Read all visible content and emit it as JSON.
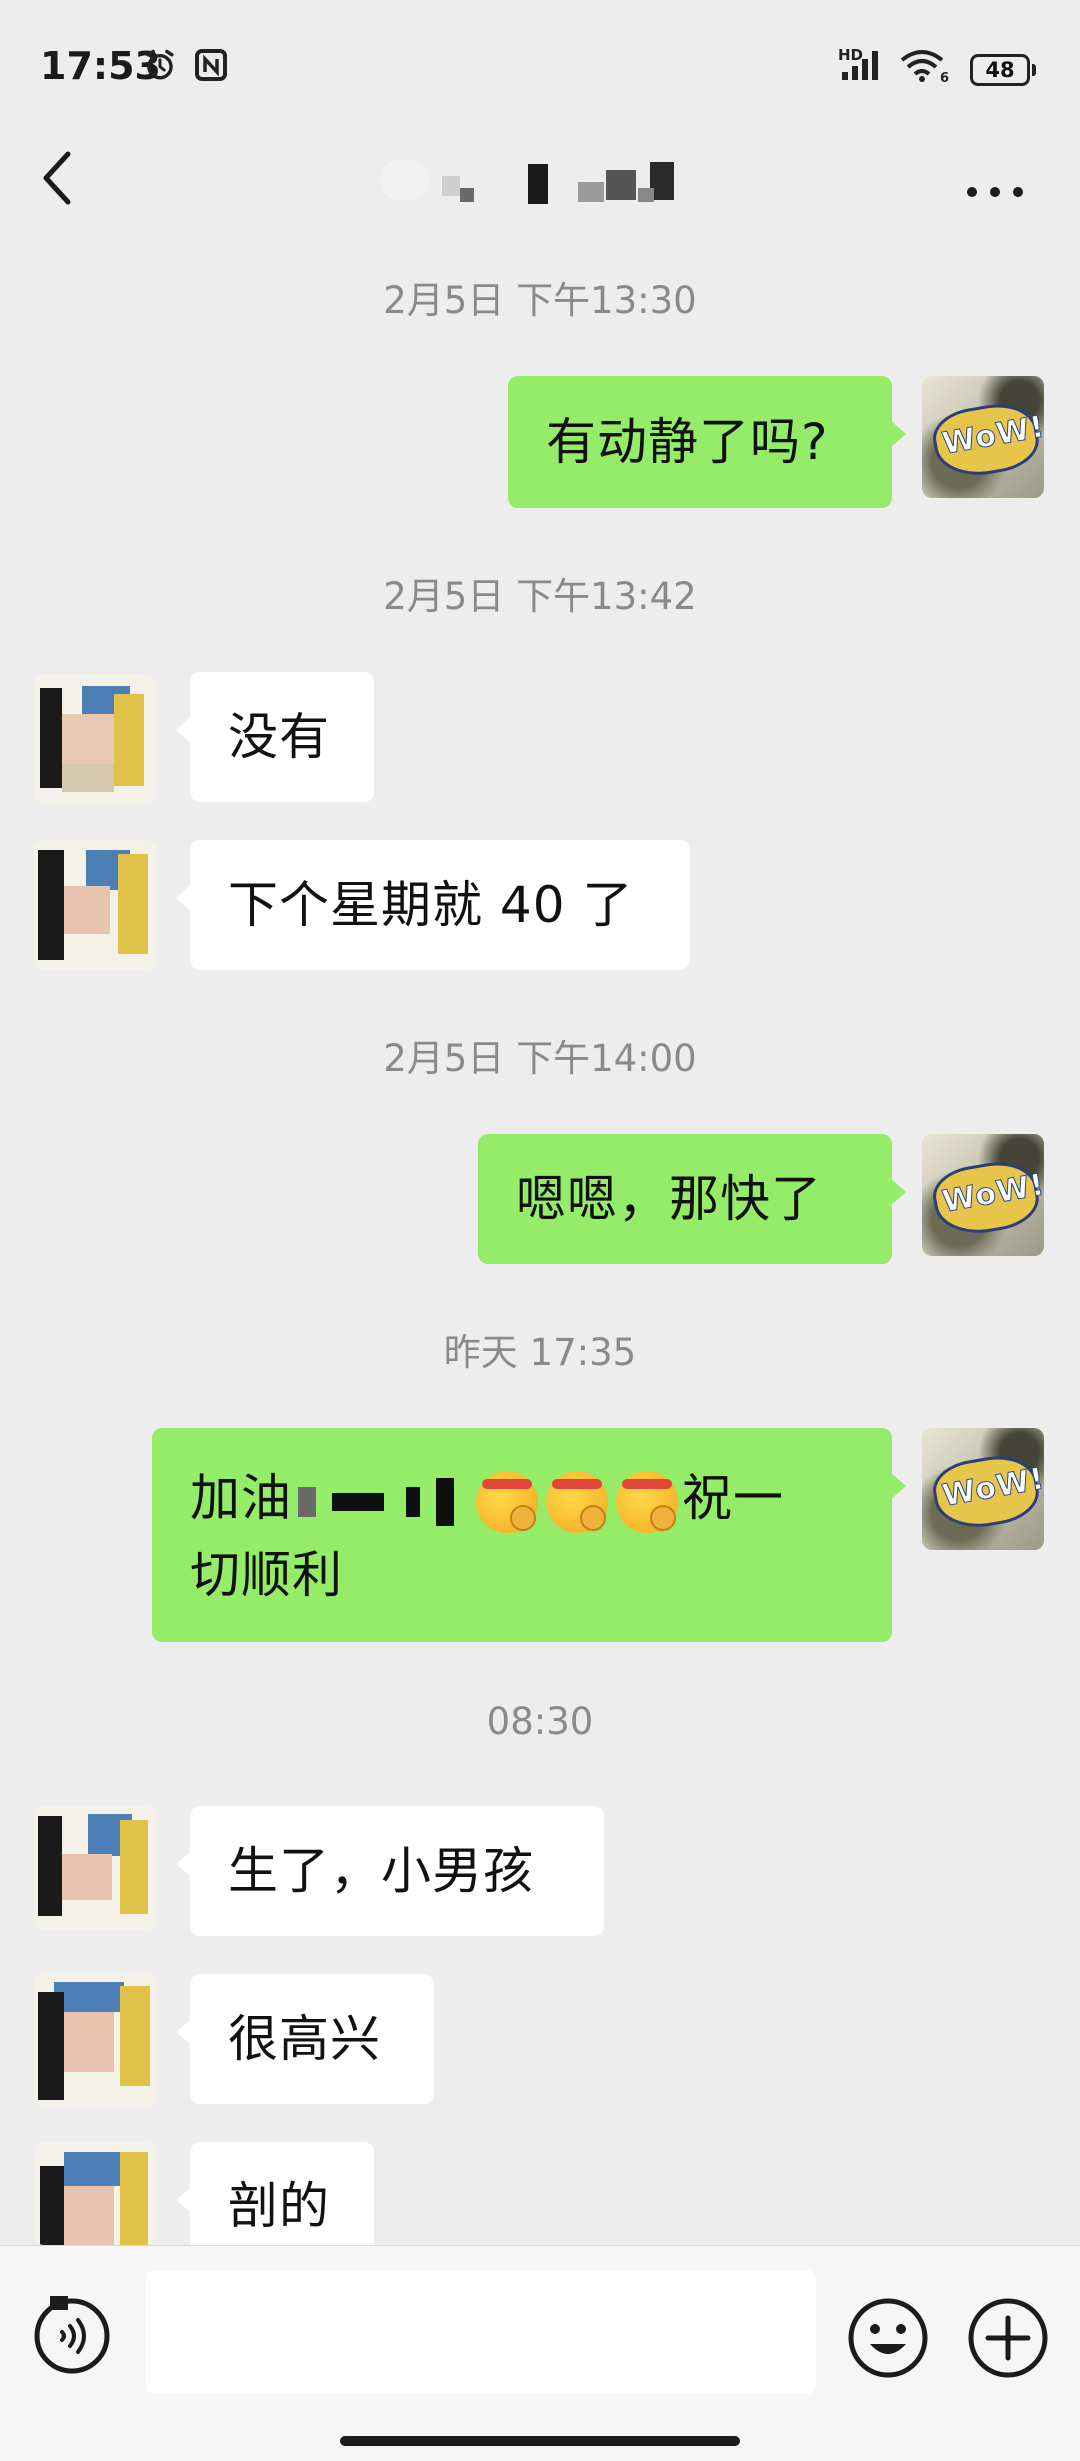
{
  "status_bar": {
    "time": "17:53",
    "battery": "48",
    "signal_label": "HD"
  },
  "header": {
    "title": "",
    "back_icon": "chevron-left-icon",
    "more_icon": "more-dots-icon"
  },
  "messages": [
    {
      "type": "timestamp",
      "text": "2月5日 下午13:30"
    },
    {
      "type": "sent",
      "text": "有动静了吗?"
    },
    {
      "type": "timestamp",
      "text": "2月5日 下午13:42"
    },
    {
      "type": "received",
      "text": "没有"
    },
    {
      "type": "received",
      "text": "下个星期就 40 了"
    },
    {
      "type": "timestamp",
      "text": "2月5日 下午14:00"
    },
    {
      "type": "sent",
      "text": "嗯嗯，那快了"
    },
    {
      "type": "timestamp",
      "text": "昨天 17:35"
    },
    {
      "type": "sent",
      "text_start": "加油",
      "text_end": "祝一",
      "text_line2": "切顺利",
      "emoji_count": 3
    },
    {
      "type": "timestamp",
      "text": "08:30"
    },
    {
      "type": "received",
      "text": "生了，小男孩"
    },
    {
      "type": "received",
      "text": "很高兴"
    },
    {
      "type": "received",
      "text": "剖的"
    }
  ],
  "input_bar": {
    "voice_icon": "voice-icon",
    "input_value": "",
    "emoji_icon": "emoji-icon",
    "plus_icon": "plus-icon"
  },
  "colors": {
    "background": "#ededed",
    "sent_bubble": "#95ec69",
    "received_bubble": "#ffffff",
    "timestamp_text": "#8a8a8a"
  }
}
